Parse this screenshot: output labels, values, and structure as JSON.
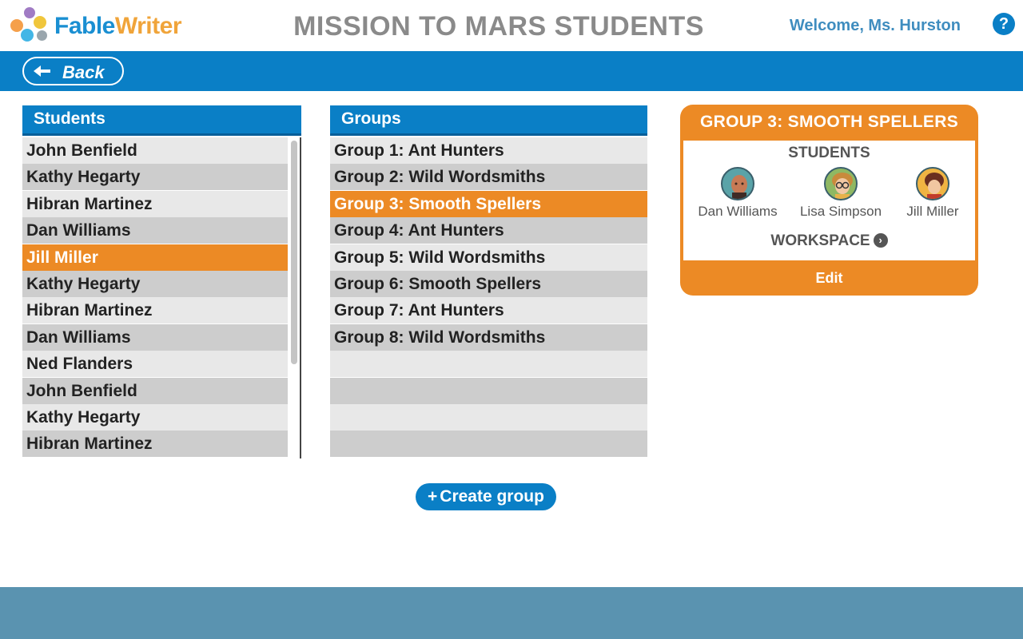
{
  "app": {
    "name_part1": "Fable",
    "name_part2": "Writer"
  },
  "header": {
    "title": "MISSION TO MARS STUDENTS",
    "welcome": "Welcome, Ms. Hurston",
    "help_label": "?"
  },
  "nav": {
    "back_label": "Back"
  },
  "students": {
    "heading": "Students",
    "selected_index": 4,
    "items": [
      "John Benfield",
      "Kathy Hegarty",
      "Hibran Martinez",
      "Dan Williams",
      "Jill Miller",
      "Kathy Hegarty",
      "Hibran Martinez",
      "Dan Williams",
      "Ned Flanders",
      "John Benfield",
      "Kathy Hegarty",
      "Hibran Martinez"
    ]
  },
  "groups": {
    "heading": "Groups",
    "selected_index": 2,
    "items": [
      "Group 1: Ant Hunters",
      "Group 2: Wild Wordsmiths",
      "Group 3: Smooth Spellers",
      "Group 4: Ant Hunters",
      "Group 5: Wild Wordsmiths",
      "Group 6: Smooth Spellers",
      "Group 7: Ant Hunters",
      "Group 8: Wild Wordsmiths",
      "",
      "",
      "",
      ""
    ],
    "create_label": "Create group",
    "create_icon": "+"
  },
  "group_card": {
    "title": "GROUP 3: SMOOTH SPELLERS",
    "students_label": "STUDENTS",
    "members": [
      {
        "name": "Dan Williams",
        "avatar": "boy-avatar-icon"
      },
      {
        "name": "Lisa Simpson",
        "avatar": "girl-glasses-avatar-icon"
      },
      {
        "name": "Jill Miller",
        "avatar": "girl-avatar-icon"
      }
    ],
    "workspace_label": "WORKSPACE",
    "workspace_icon": "›",
    "edit_label": "Edit"
  },
  "colors": {
    "primary_blue": "#0a7fc6",
    "selected_orange": "#ec8a25",
    "footer": "#5a93b0",
    "title_gray": "#8a8a8a"
  }
}
